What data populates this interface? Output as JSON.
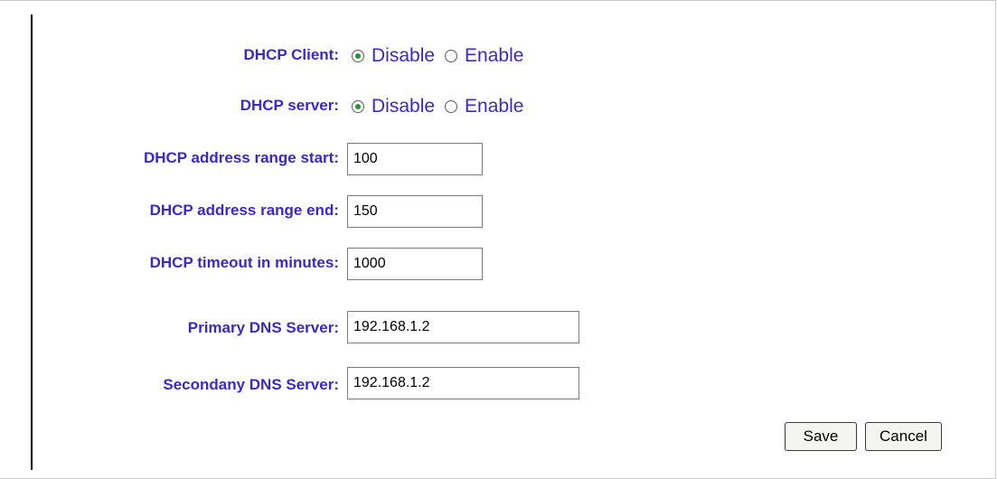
{
  "form": {
    "dhcp_client": {
      "label": "DHCP Client:",
      "options": [
        "Disable",
        "Enable"
      ],
      "selected": "Disable"
    },
    "dhcp_server": {
      "label": "DHCP server:",
      "options": [
        "Disable",
        "Enable"
      ],
      "selected": "Disable"
    },
    "range_start": {
      "label": "DHCP address range start:",
      "value": "100"
    },
    "range_end": {
      "label": "DHCP address range end:",
      "value": "150"
    },
    "timeout": {
      "label": "DHCP timeout in minutes:",
      "value": "1000"
    },
    "primary_dns": {
      "label": "Primary DNS Server:",
      "value": "192.168.1.2"
    },
    "secondary_dns": {
      "label": "Secondany DNS Server:",
      "value": "192.168.1.2"
    }
  },
  "buttons": {
    "save": "Save",
    "cancel": "Cancel"
  },
  "colors": {
    "label": "#3a28cc",
    "radio_dot": "#1e9a2e"
  }
}
